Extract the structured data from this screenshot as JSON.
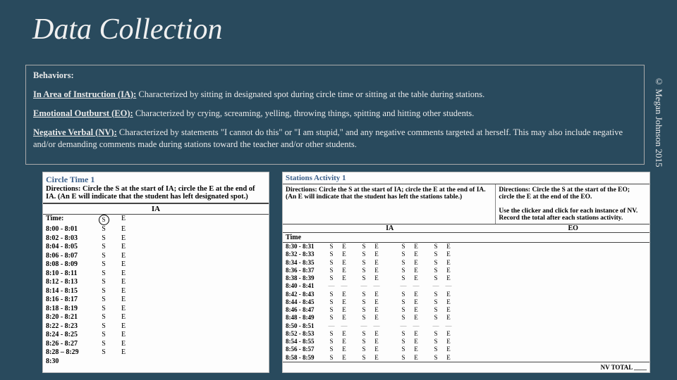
{
  "title": "Data Collection",
  "copyright": "© Megan Johnson 2015",
  "behaviors": {
    "heading": "Behaviors:",
    "ia_label": "In Area of Instruction (IA):",
    "ia_text": " Characterized by sitting in designated spot during circle time or sitting at the table during stations.",
    "eo_label": "Emotional Outburst (EO):",
    "eo_text": " Characterized by crying, screaming, yelling, throwing things, spitting and hitting other students.",
    "nv_label": "Negative Verbal (NV):",
    "nv_text": "  Characterized by statements \"I cannot do this\" or \"I am stupid,\" and any negative comments targeted at herself.  This may also include negative and/or demanding comments made during stations toward the teacher and/or other students."
  },
  "sheet1": {
    "title": "Circle Time 1",
    "directions": "Directions: Circle the S at the start of IA; circle the E at the end of IA. (An E will indicate that the student has left designated spot.)",
    "ia": "IA",
    "time": "Time:",
    "firstS": "S",
    "firstE": "E",
    "rows": [
      {
        "t": "8:00 - 8:01",
        "s": "S",
        "e": "E"
      },
      {
        "t": "8:02 - 8:03",
        "s": "S",
        "e": "E"
      },
      {
        "t": "8:04 - 8:05",
        "s": "S",
        "e": "E"
      },
      {
        "t": "8:06 - 8:07",
        "s": "S",
        "e": "E"
      },
      {
        "t": "8:08 - 8:09",
        "s": "S",
        "e": "E"
      },
      {
        "t": "8:10 - 8:11",
        "s": "S",
        "e": "E"
      },
      {
        "t": "8:12 - 8:13",
        "s": "S",
        "e": "E"
      },
      {
        "t": "8:14 - 8:15",
        "s": "S",
        "e": "E"
      },
      {
        "t": "8:16 - 8:17",
        "s": "S",
        "e": "E"
      },
      {
        "t": "8:18 - 8:19",
        "s": "S",
        "e": "E"
      },
      {
        "t": "8:20 - 8:21",
        "s": "S",
        "e": "E"
      },
      {
        "t": "8:22 - 8:23",
        "s": "S",
        "e": "E"
      },
      {
        "t": "8:24 - 8:25",
        "s": "S",
        "e": "E"
      },
      {
        "t": "8:26 - 8:27",
        "s": "S",
        "e": "E"
      },
      {
        "t": "8:28 – 8:29",
        "s": "S",
        "e": "E"
      },
      {
        "t": "8:30",
        "s": "",
        "e": ""
      }
    ]
  },
  "sheet2": {
    "title": "Stations Activity 1",
    "col1_dir": "Directions:  Circle the S at the start of IA; circle the E at the end of IA.  (An E will indicate that the student has left the stations table.)",
    "col2_dir": "Directions: Circle the S at the start of the EO; circle the E at the end of the EO.",
    "col2_note": "Use the clicker and click for each instance of NV. Record the total after each stations activity.",
    "ia": "IA",
    "eo": "EO",
    "time": "Time",
    "nv_total": "NV TOTAL ____",
    "rows": [
      {
        "t": "8:30 - 8:31",
        "a": [
          "S",
          "E",
          "S",
          "E"
        ],
        "b": [
          "S",
          "E",
          "S",
          "E"
        ]
      },
      {
        "t": "8:32 - 8:33",
        "a": [
          "S",
          "E",
          "S",
          "E"
        ],
        "b": [
          "S",
          "E",
          "S",
          "E"
        ]
      },
      {
        "t": "8:34 - 8:35",
        "a": [
          "S",
          "E",
          "S",
          "E"
        ],
        "b": [
          "S",
          "E",
          "S",
          "E"
        ]
      },
      {
        "t": "8:36 - 8:37",
        "a": [
          "S",
          "E",
          "S",
          "E"
        ],
        "b": [
          "S",
          "E",
          "S",
          "E"
        ]
      },
      {
        "t": "8:38 - 8:39",
        "a": [
          "S",
          "E",
          "S",
          "E"
        ],
        "b": [
          "S",
          "E",
          "S",
          "E"
        ]
      },
      {
        "t": "8:40 - 8:41",
        "a": [
          "-",
          "-",
          "-",
          "-"
        ],
        "b": [
          "-",
          "-",
          "-",
          "-"
        ]
      },
      {
        "t": "8:42 - 8:43",
        "a": [
          "S",
          "E",
          "S",
          "E"
        ],
        "b": [
          "S",
          "E",
          "S",
          "E"
        ]
      },
      {
        "t": "8:44 - 8:45",
        "a": [
          "S",
          "E",
          "S",
          "E"
        ],
        "b": [
          "S",
          "E",
          "S",
          "E"
        ]
      },
      {
        "t": "8:46 - 8:47",
        "a": [
          "S",
          "E",
          "S",
          "E"
        ],
        "b": [
          "S",
          "E",
          "S",
          "E"
        ]
      },
      {
        "t": "8:48 - 8:49",
        "a": [
          "S",
          "E",
          "S",
          "E"
        ],
        "b": [
          "S",
          "E",
          "S",
          "E"
        ]
      },
      {
        "t": "8:50 - 8:51",
        "a": [
          "-",
          "-",
          "-",
          "-"
        ],
        "b": [
          "-",
          "-",
          "-",
          "-"
        ]
      },
      {
        "t": "8:52 - 8:53",
        "a": [
          "S",
          "E",
          "S",
          "E"
        ],
        "b": [
          "S",
          "E",
          "S",
          "E"
        ]
      },
      {
        "t": "8:54 - 8:55",
        "a": [
          "S",
          "E",
          "S",
          "E"
        ],
        "b": [
          "S",
          "E",
          "S",
          "E"
        ]
      },
      {
        "t": "8:56 - 8:57",
        "a": [
          "S",
          "E",
          "S",
          "E"
        ],
        "b": [
          "S",
          "E",
          "S",
          "E"
        ]
      },
      {
        "t": "8:58 - 8:59",
        "a": [
          "S",
          "E",
          "S",
          "E"
        ],
        "b": [
          "S",
          "E",
          "S",
          "E"
        ]
      }
    ]
  }
}
